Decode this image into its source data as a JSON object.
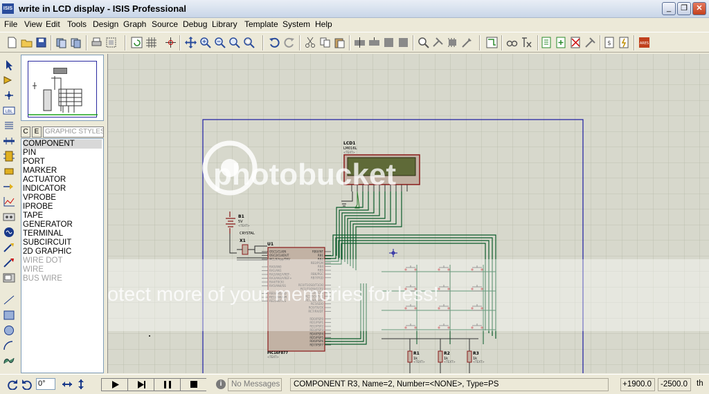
{
  "window": {
    "title": "write in LCD display - ISIS Professional",
    "app_icon": "ISIS"
  },
  "menu": [
    "File",
    "View",
    "Edit",
    "Tools",
    "Design",
    "Graph",
    "Source",
    "Debug",
    "Library",
    "Template",
    "System",
    "Help"
  ],
  "panel": {
    "tab_c": "C",
    "tab_e": "E",
    "selector_label": "GRAPHIC STYLES",
    "modes": [
      "COMPONENT",
      "PIN",
      "PORT",
      "MARKER",
      "ACTUATOR",
      "INDICATOR",
      "VPROBE",
      "IPROBE",
      "TAPE",
      "GENERATOR",
      "TERMINAL",
      "SUBCIRCUIT",
      "2D GRAPHIC",
      "WIRE DOT",
      "WIRE",
      "BUS WIRE"
    ],
    "selected_mode": "COMPONENT",
    "disabled_modes": [
      "WIRE DOT",
      "WIRE",
      "BUS WIRE"
    ]
  },
  "schematic": {
    "lcd_ref": "LCD1",
    "lcd_part": "LM016L",
    "mcu_ref": "U1",
    "mcu_part": "PIC16F877",
    "battery_ref": "B1",
    "battery_value": "5V",
    "crystal_ref": "X1",
    "crystal_value": "CRYSTAL",
    "resistors": [
      {
        "ref": "R1",
        "value": "1k"
      },
      {
        "ref": "R2",
        "value": "1k"
      },
      {
        "ref": "R3",
        "value": "1k"
      }
    ],
    "text_placeholder": "<TEXT>",
    "mcu_pins_left": [
      "OSC1/CLKIN",
      "OSC2/CLKOUT",
      "MCLR/Vpp/THV",
      "",
      "RA0/AN0",
      "RA1/AN1",
      "RA2/AN2/VREF-",
      "RA3/AN3/VREF+",
      "RA4/T0CKI",
      "RA5/AN4/SS",
      "",
      "RE0/AN5/RD",
      "RE1/AN6/WR",
      "RE2/AN7/CS"
    ],
    "mcu_pins_right": [
      "RB0/INT",
      "RB1",
      "RB2",
      "RB3/PGM",
      "RB4",
      "RB5",
      "RB6/PGC",
      "RB7/PGD",
      "",
      "RC0/T1OSO/T1CKI",
      "RC1/T1OSI/CCP2",
      "RC2/CCP1",
      "RC3/SCK/SCL",
      "RC4/SDI/SDA",
      "RC5/SDO",
      "RC6/TX/CK",
      "RC7/RX/DT",
      "",
      "RD0/PSP0",
      "RD1/PSP1",
      "RD2/PSP2",
      "RD3/PSP3",
      "RD4/PSP4",
      "RD5/PSP5",
      "RD6/PSP6",
      "RD7/PSP7"
    ],
    "watermark_logo": "photobucket",
    "watermark_text": "Protect more of your memories for less!"
  },
  "status": {
    "angle": "0°",
    "messages": "No Messages",
    "component_info": "COMPONENT R3, Name=2, Number=<NONE>, Type=PS",
    "x": "+1900.0",
    "y": "-2500.0",
    "unit": "th"
  }
}
